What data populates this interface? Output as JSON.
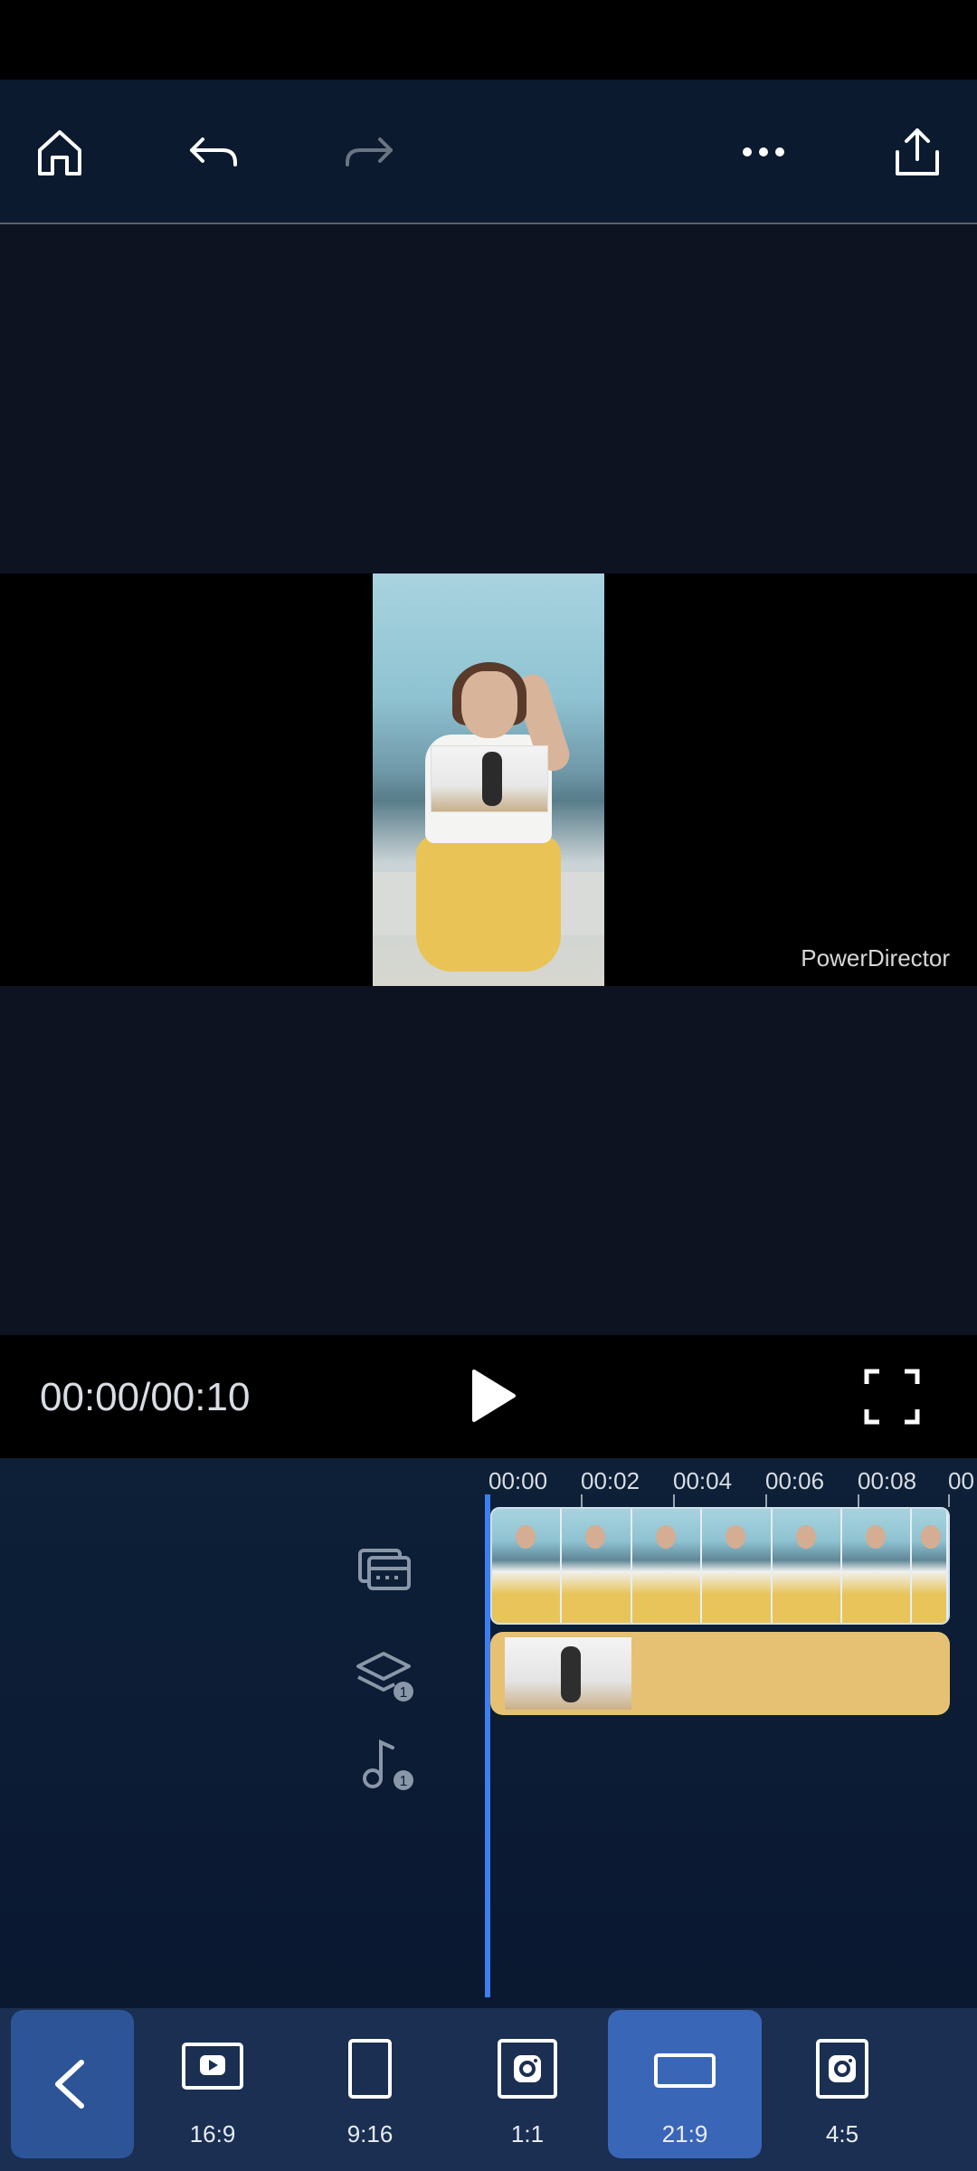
{
  "toolbar": {
    "home_icon": "home-icon",
    "undo_icon": "undo-icon",
    "redo_icon": "redo-icon",
    "more_icon": "more-icon",
    "export_icon": "share-icon"
  },
  "preview": {
    "watermark": "PowerDirector"
  },
  "playback": {
    "timecode": "00:00/00:10"
  },
  "timeline": {
    "ruler": [
      "00:00",
      "00:02",
      "00:04",
      "00:06",
      "00:08",
      "00"
    ],
    "overlay_count": "1",
    "audio_count": "1"
  },
  "aspect_ratios": {
    "items": [
      {
        "label": "16:9",
        "icon": "youtube-icon"
      },
      {
        "label": "9:16",
        "icon": "portrait-icon"
      },
      {
        "label": "1:1",
        "icon": "instagram-icon"
      },
      {
        "label": "21:9",
        "icon": "widescreen-icon",
        "selected": true
      },
      {
        "label": "4:5",
        "icon": "instagram-icon"
      }
    ]
  },
  "colors": {
    "accent": "#3a66b8",
    "playhead": "#3d7ef0",
    "overlay_track": "#e7c173"
  }
}
